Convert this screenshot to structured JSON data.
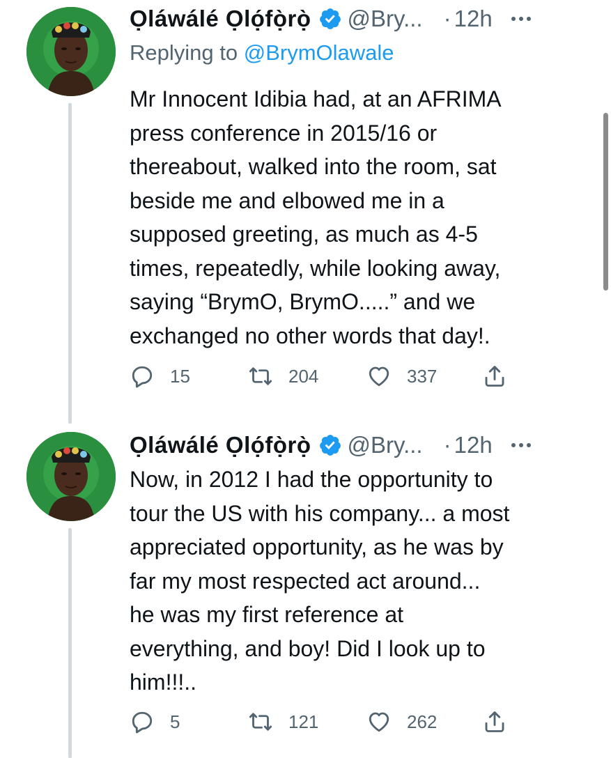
{
  "tweets": [
    {
      "author": {
        "display_name": "Ọláwálé  Ọlọ́fọ̀rọ̀",
        "handle": "@Bry...",
        "verified": true
      },
      "timestamp_sep": "·",
      "timestamp": "12h",
      "replying_to_label": "Replying to",
      "replying_to_handle": "@BrymOlawale",
      "text": "Mr Innocent Idibia had, at an AFRIMA\npress conference in 2015/16 or\nthereabout, walked into the room, sat\nbeside me and elbowed me in a\nsupposed greeting, as much as 4-5\ntimes, repeatedly, while looking away,\nsaying  “BrymO, BrymO.....” and we\nexchanged no other words that day!.",
      "replies": "15",
      "retweets": "204",
      "likes": "337"
    },
    {
      "author": {
        "display_name": "Ọláwálé  Ọlọ́fọ̀rọ̀",
        "handle": "@Bry...",
        "verified": true
      },
      "timestamp_sep": "·",
      "timestamp": "12h",
      "text": "Now, in 2012 I had the opportunity to\ntour the US with his company... a most\nappreciated opportunity, as he was by\nfar my most respected act around...\nhe was my first reference at\neverything, and boy! Did I look up to\nhim!!!..",
      "replies": "5",
      "retweets": "121",
      "likes": "262"
    }
  ],
  "icons": {
    "verified": "verified-badge-icon",
    "more": "more-horizontal-icon",
    "reply": "reply-icon",
    "retweet": "retweet-icon",
    "like": "heart-icon",
    "share": "share-icon"
  },
  "colors": {
    "text_primary": "#0f1419",
    "text_secondary": "#536471",
    "link": "#1d9bf0",
    "verified": "#1d9bf0",
    "thread_line": "#cfd9de",
    "avatar_bg": "#2a8f3f"
  }
}
